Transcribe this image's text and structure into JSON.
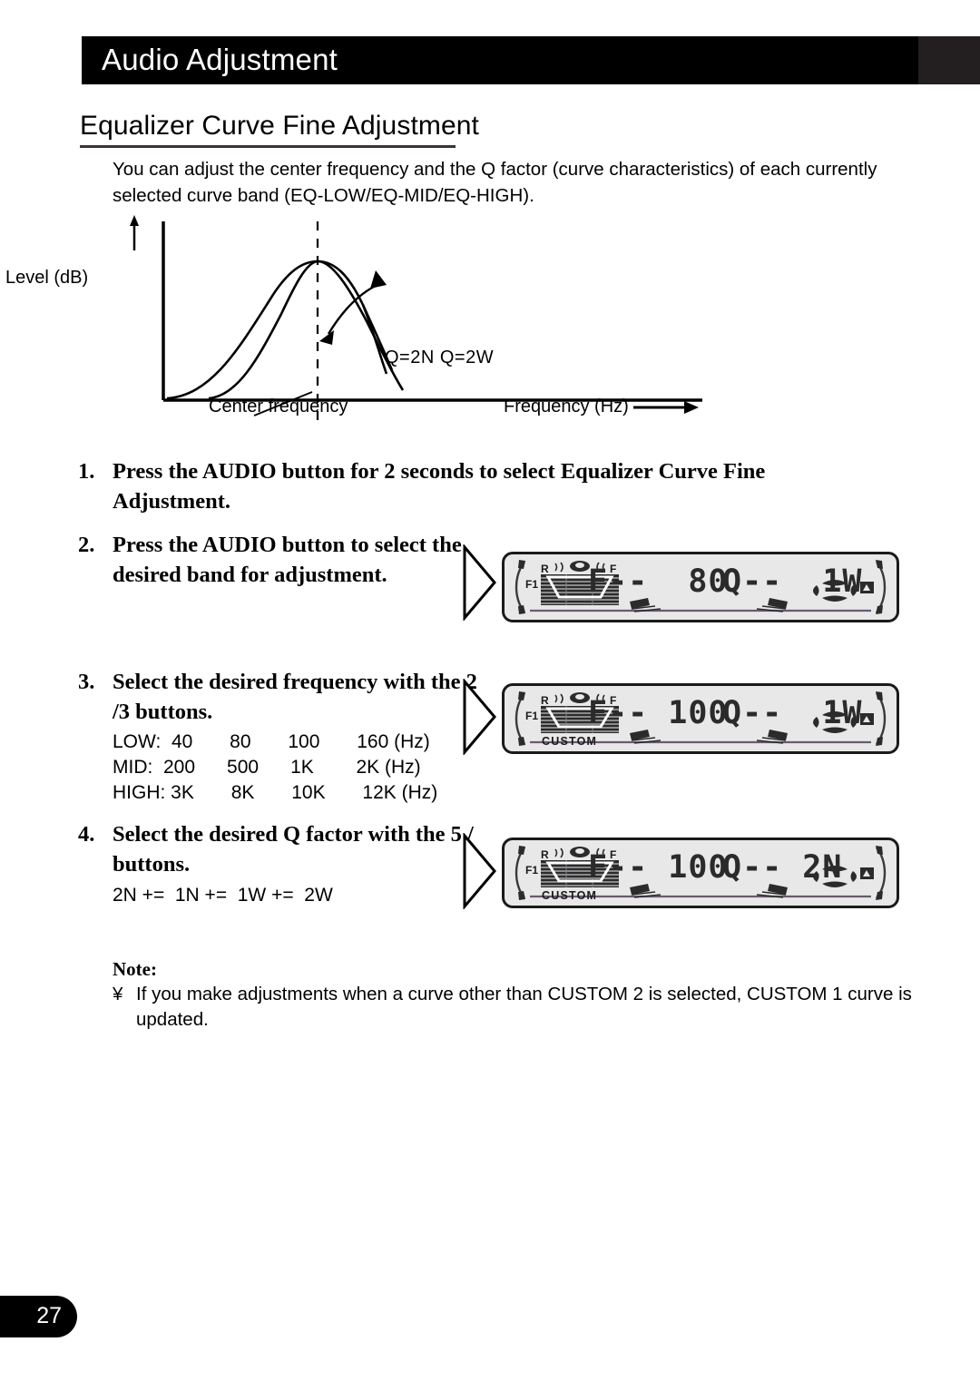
{
  "header": {
    "title": "Audio Adjustment"
  },
  "section": {
    "heading": "Equalizer Curve Fine Adjustment",
    "intro": "You can adjust the center frequency and the Q factor (curve characteristics) of each currently selected curve band (EQ-LOW/EQ-MID/EQ-HIGH)."
  },
  "graph": {
    "y_axis_label": "Level (dB)",
    "x_axis_label": "Frequency (Hz)",
    "center_label": "Center frequency",
    "curve_labels": "Q=2N  Q=2W"
  },
  "steps": [
    {
      "num": "1.",
      "text": "Press the AUDIO button for 2 seconds to select Equalizer Curve Fine Adjustment."
    },
    {
      "num": "2.",
      "text": "Press the AUDIO button to select the desired band for adjustment."
    },
    {
      "num": "3.",
      "text": "Select the desired frequency with the 2 /3  buttons."
    },
    {
      "num": "4.",
      "text": "Select the desired Q factor with the 5 /   buttons."
    }
  ],
  "frequency_list": "LOW:  40       80       100       160 (Hz)\nMID:  200      500      1K        2K (Hz)\nHIGH: 3K       8K       10K       12K (Hz)",
  "q_factor_list": "2N +=  1N +=  1W +=  2W",
  "lcd_panels": [
    {
      "freq_text": "F--  80",
      "q_text": "Q--  1W",
      "custom_tag": "",
      "left_label": "R",
      "right_label": "F",
      "f1_label": "F1"
    },
    {
      "freq_text": "F-- 100",
      "q_text": "Q--  1W",
      "custom_tag": "CUSTOM",
      "left_label": "R",
      "right_label": "F",
      "f1_label": "F1"
    },
    {
      "freq_text": "F-- 100",
      "q_text": "Q-- 2N",
      "custom_tag": "CUSTOM",
      "left_label": "R",
      "right_label": "F",
      "f1_label": "F1"
    }
  ],
  "note": {
    "heading": "Note:",
    "bullet": "¥",
    "text": "If you make adjustments when a curve other than  CUSTOM 2  is selected,  CUSTOM 1  curve is updated."
  },
  "page_number": "27",
  "colors": {
    "header_bg": "#000000",
    "header_tail": "#231f20",
    "lcd_bg": "#e8e8e8",
    "lcd_border": "#1a1a1a",
    "meter_accent": "#6a5a72"
  }
}
